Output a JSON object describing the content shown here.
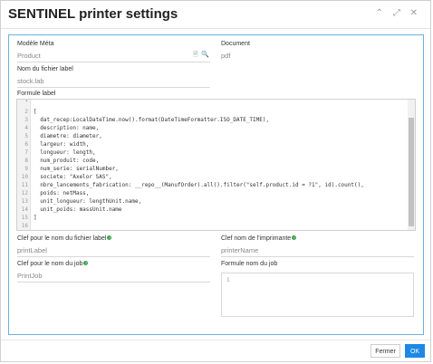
{
  "dialog": {
    "title": "SENTINEL printer settings",
    "window_icons": "⌃ ⤢ ✕"
  },
  "fields": {
    "modele_meta": {
      "label": "Modèle Méta",
      "value": "Product"
    },
    "document": {
      "label": "Document",
      "value": "pdf"
    },
    "nom_fichier_label": {
      "label": "Nom du fichier label",
      "value": "stock.lab"
    },
    "formule_label": {
      "label": "Formule label"
    },
    "clef_nom_fichier_label": {
      "label": "Clef pour le nom du fichier label",
      "value": "printLabel"
    },
    "clef_nom_imprimante": {
      "label": "Clef nom de l'imprimante",
      "value": "printerName"
    },
    "clef_nom_job": {
      "label": "Clef pour le nom du job",
      "value": "PrintJob"
    },
    "formule_nom_job": {
      "label": "Formule nom du job",
      "line_number": "1"
    }
  },
  "code": {
    "lines": [
      {
        "n": "",
        "text": ""
      },
      {
        "n": "2",
        "text": "["
      },
      {
        "n": "3",
        "text": "  dat_recep:LocalDateTime.now().format(DateTimeFormatter.ISO_DATE_TIME),"
      },
      {
        "n": "4",
        "text": "  description: name,"
      },
      {
        "n": "5",
        "text": "  diametre: diameter,"
      },
      {
        "n": "6",
        "text": "  largeur: width,"
      },
      {
        "n": "7",
        "text": "  longueur: length,"
      },
      {
        "n": "8",
        "text": "  num_produit: code,"
      },
      {
        "n": "9",
        "text": "  num_serie: serialNumber,"
      },
      {
        "n": "10",
        "text": "  societe: \"Axelor SAS\","
      },
      {
        "n": "11",
        "text": "  nbre_lancements_fabrication: __repo__(ManufOrder).all().filter(\"self.product.id = ?1\", id).count(),"
      },
      {
        "n": "12",
        "text": "  poids: netMass,"
      },
      {
        "n": "13",
        "text": "  unit_longueur: lengthUnit.name,"
      },
      {
        "n": "14",
        "text": "  unit_poids: massUnit.name"
      },
      {
        "n": "15",
        "text": "]"
      }
    ]
  },
  "footer": {
    "cancel_label": "Fermer",
    "ok_label": "OK"
  }
}
